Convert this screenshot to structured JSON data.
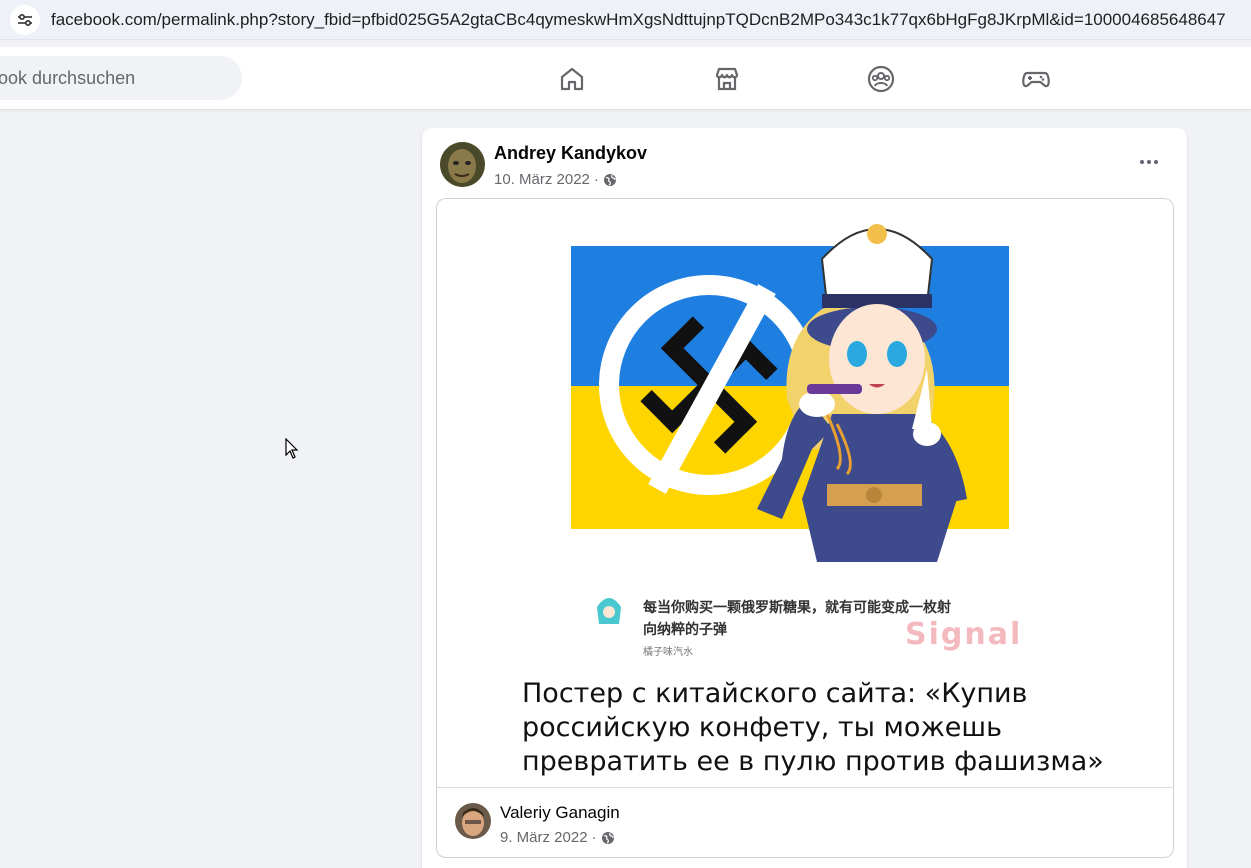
{
  "browser": {
    "url": "facebook.com/permalink.php?story_fbid=pfbid025G5A2gtaCBc4qymeskwHmXgsNdttujnpTQDcnB2MPo343c1k77qx6bHgFg8JKrpMl&id=100004685648647"
  },
  "nav": {
    "search_placeholder": "ebook durchsuchen",
    "icons": [
      "home-icon",
      "marketplace-icon",
      "groups-icon",
      "gaming-icon"
    ]
  },
  "post": {
    "author": "Andrey Kandykov",
    "date": "10. März 2022",
    "separator": "·",
    "shared": {
      "cn_text_line1": "每当你购买一颗俄罗斯糖果，就有可能变成一枚射",
      "cn_text_line2": "向纳粹的子弹",
      "cn_author": "橘子味汽水",
      "watermark": "Signal",
      "caption": "Постер с китайского сайта: «Купив российскую конфету, ты можешь превратить ее в пулю против фашизма»",
      "author": "Valeriy Ganagin",
      "date": "9. März 2022",
      "separator": "·"
    }
  },
  "colors": {
    "flag_blue": "#1f7fe0",
    "flag_yellow": "#ffd500",
    "uniform": "#3d4a8c"
  }
}
